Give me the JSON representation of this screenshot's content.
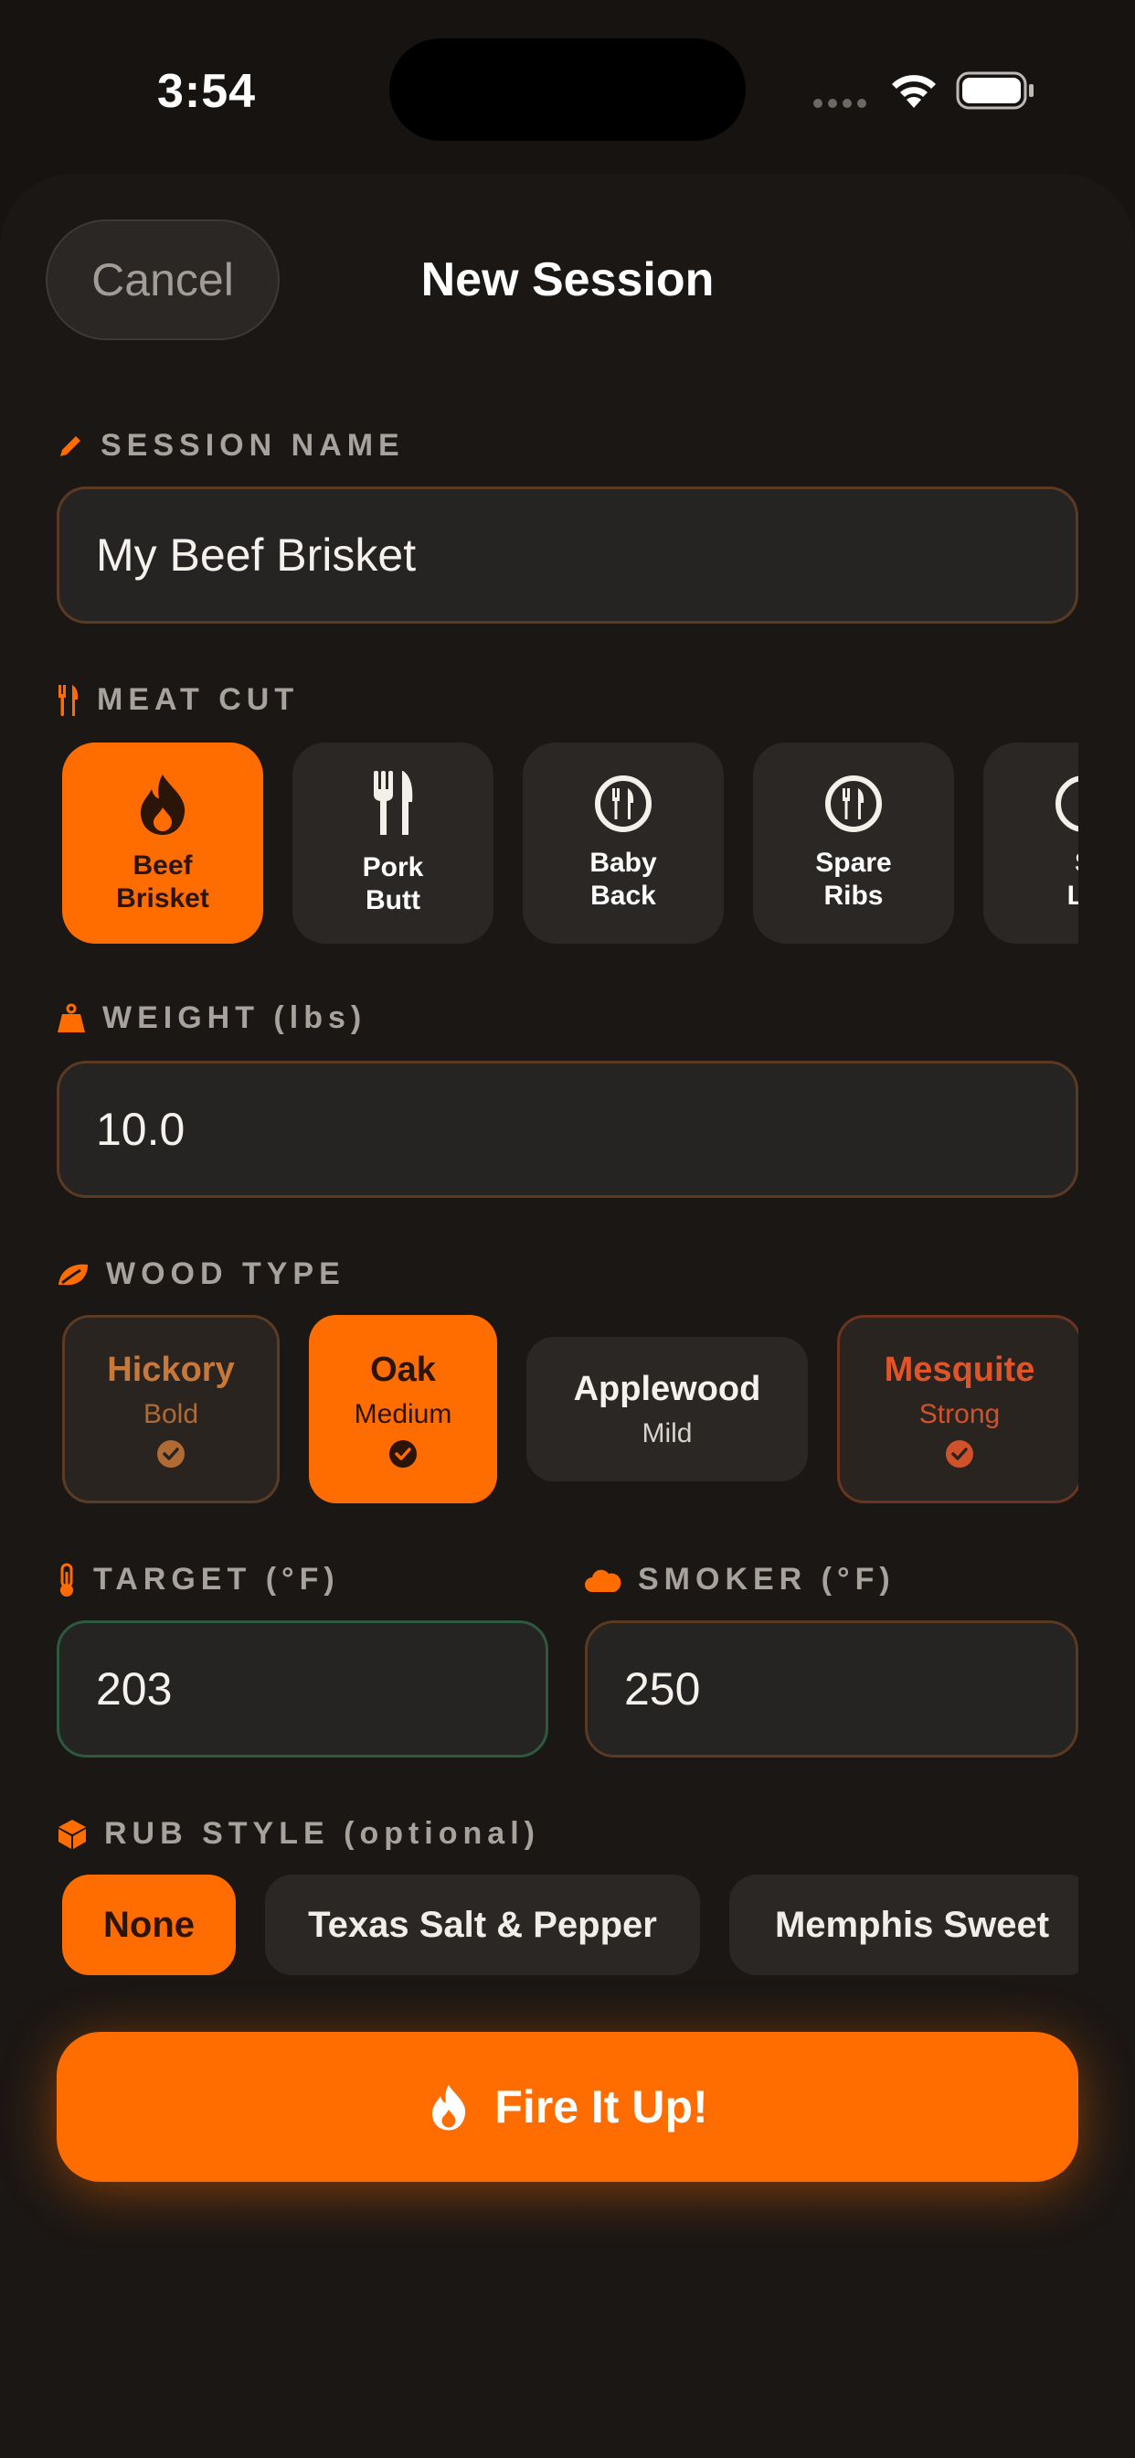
{
  "status_bar": {
    "time": "3:54"
  },
  "header": {
    "cancel_label": "Cancel",
    "title": "New Session"
  },
  "session_name": {
    "label": "SESSION NAME",
    "value": "My Beef Brisket"
  },
  "meat_cut": {
    "label": "MEAT CUT",
    "items": [
      {
        "label": "Beef\nBrisket",
        "icon": "flame-icon",
        "selected": true
      },
      {
        "label": "Pork\nButt",
        "icon": "fork-knife-icon",
        "selected": false
      },
      {
        "label": "Baby\nBack",
        "icon": "plate-utensils-icon",
        "selected": false
      },
      {
        "label": "Spare\nRibs",
        "icon": "plate-utensils-icon",
        "selected": false
      },
      {
        "label": "S\nLo",
        "icon": "plate-utensils-icon",
        "selected": false
      }
    ]
  },
  "weight": {
    "label": "WEIGHT (lbs)",
    "value": "10.0"
  },
  "wood_type": {
    "label": "WOOD TYPE",
    "items": [
      {
        "name": "Hickory",
        "strength": "Bold",
        "checked": true,
        "selected": false
      },
      {
        "name": "Oak",
        "strength": "Medium",
        "checked": true,
        "selected": true
      },
      {
        "name": "Applewood",
        "strength": "Mild",
        "checked": false,
        "selected": false
      },
      {
        "name": "Mesquite",
        "strength": "Strong",
        "checked": true,
        "selected": false
      }
    ]
  },
  "target": {
    "label": "TARGET (°F)",
    "value": "203"
  },
  "smoker": {
    "label": "SMOKER (°F)",
    "value": "250"
  },
  "rub_style": {
    "label": "RUB STYLE (optional)",
    "items": [
      {
        "label": "None",
        "selected": true
      },
      {
        "label": "Texas Salt & Pepper",
        "selected": false
      },
      {
        "label": "Memphis Sweet",
        "selected": false
      }
    ]
  },
  "fire_button": {
    "label": "Fire It Up!"
  },
  "colors": {
    "accent": "#ff6c00",
    "hickory": "#c8783a",
    "mesquite": "#e0542a",
    "background": "#1b1714"
  }
}
